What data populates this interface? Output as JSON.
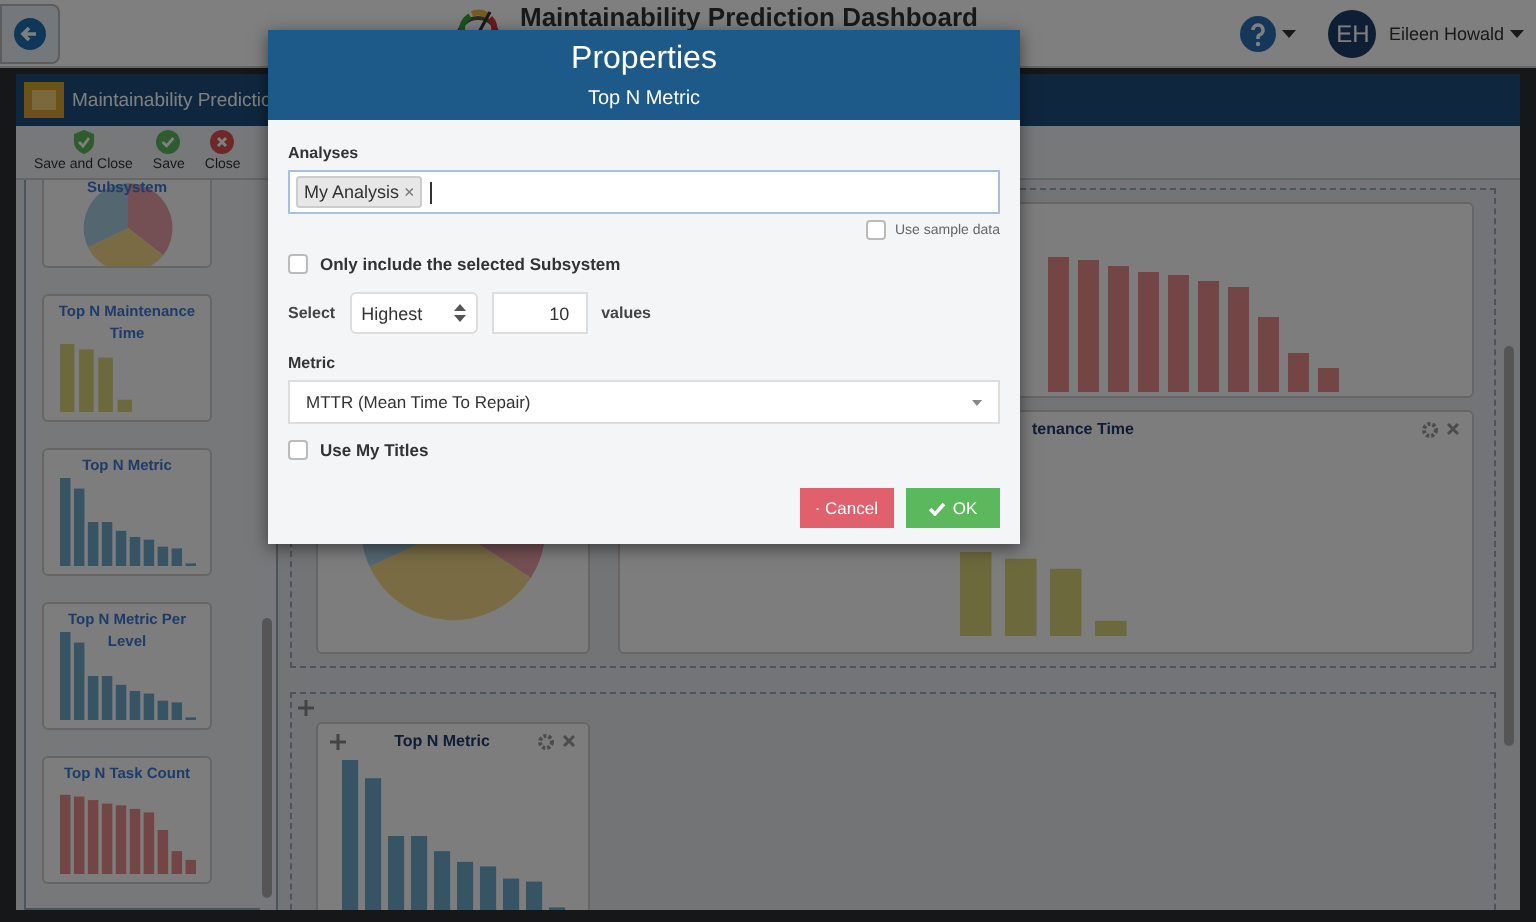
{
  "header": {
    "title": "Maintainability Prediction Dashboard",
    "user_initials": "EH",
    "user_name": "Eileen Howald"
  },
  "window": {
    "title": "Maintainability Predictio"
  },
  "toolbar": [
    {
      "label": "Save and Close",
      "kind": "save-close"
    },
    {
      "label": "Save",
      "kind": "save"
    },
    {
      "label": "Close",
      "kind": "close"
    }
  ],
  "palette": [
    {
      "title": "Subsystem",
      "kind": "pie"
    },
    {
      "title": "Top N Maintenance Time",
      "kind": "bars"
    },
    {
      "title": "Top N Metric",
      "kind": "bars"
    },
    {
      "title": "Top N Metric Per Level",
      "kind": "bars"
    },
    {
      "title": "Top N Task Count",
      "kind": "bars"
    }
  ],
  "dashboard": {
    "zones": [
      {
        "rows": [
          [
            {
              "kind": "bars"
            }
          ],
          [
            {
              "kind": "pie"
            },
            {
              "kind": "bars",
              "title": "tenance Time"
            }
          ]
        ]
      },
      {
        "rows": [
          [
            {
              "kind": "bars",
              "title": "Top N Metric"
            }
          ]
        ]
      }
    ]
  },
  "dialog": {
    "title": "Properties",
    "subtitle": "Top N Metric",
    "analyses_label": "Analyses",
    "analyses_tags": [
      {
        "label": "My Analysis",
        "remove": "×"
      }
    ],
    "use_sample_data": {
      "label": "Use sample data",
      "checked": false
    },
    "only_selected": {
      "label": "Only include the selected Subsystem",
      "checked": false
    },
    "select_label": "Select",
    "select_value": "Highest",
    "count": "10",
    "values_label": "values",
    "metric_label": "Metric",
    "metric_value": "MTTR (Mean Time To Repair)",
    "use_titles": {
      "label": "Use My Titles",
      "checked": false
    },
    "buttons": [
      {
        "label": "Cancel",
        "kind": "cancel"
      },
      {
        "label": "OK",
        "kind": "ok"
      }
    ]
  }
}
